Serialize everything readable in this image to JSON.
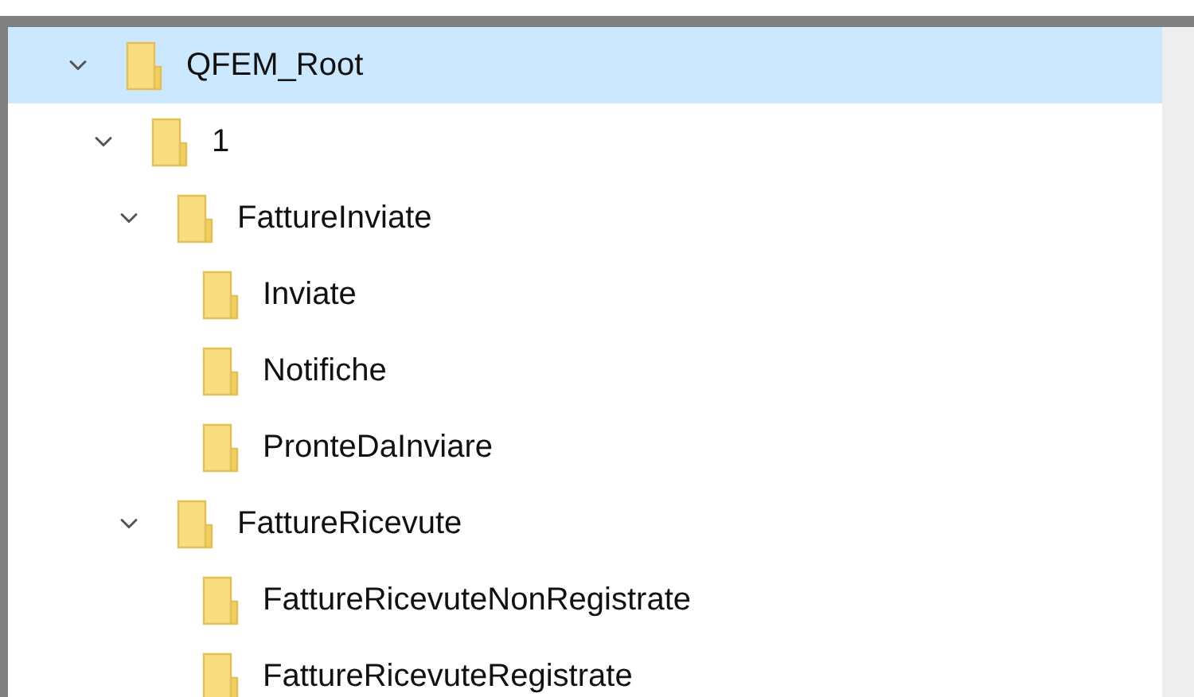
{
  "tree": [
    {
      "label": "QFEM_Root",
      "selected": true,
      "expanded": true,
      "children": [
        {
          "label": "1",
          "selected": false,
          "expanded": true,
          "children": [
            {
              "label": "FattureInviate",
              "selected": false,
              "expanded": true,
              "children": [
                {
                  "label": "Inviate",
                  "selected": false
                },
                {
                  "label": "Notifiche",
                  "selected": false
                },
                {
                  "label": "PronteDaInviare",
                  "selected": false
                }
              ]
            },
            {
              "label": "FattureRicevute",
              "selected": false,
              "expanded": true,
              "children": [
                {
                  "label": "FattureRicevuteNonRegistrate",
                  "selected": false
                },
                {
                  "label": "FattureRicevuteRegistrate",
                  "selected": false
                }
              ]
            }
          ]
        }
      ]
    }
  ]
}
